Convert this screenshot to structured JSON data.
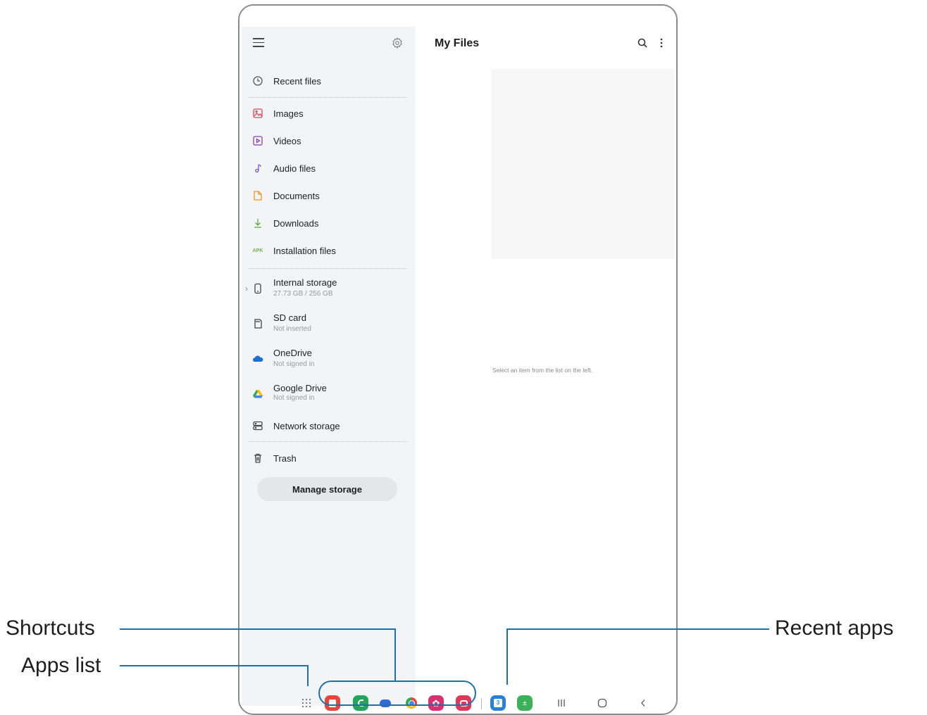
{
  "main": {
    "title": "My Files",
    "empty_message": "Select an item from the list on the left."
  },
  "sidebar": {
    "items": [
      {
        "label": "Recent files"
      },
      {
        "label": "Images"
      },
      {
        "label": "Videos"
      },
      {
        "label": "Audio files"
      },
      {
        "label": "Documents"
      },
      {
        "label": "Downloads"
      },
      {
        "label": "Installation files",
        "badge": "APK"
      },
      {
        "label": "Internal storage",
        "sub": "27.73 GB / 256 GB"
      },
      {
        "label": "SD card",
        "sub": "Not inserted"
      },
      {
        "label": "OneDrive",
        "sub": "Not signed in"
      },
      {
        "label": "Google Drive",
        "sub": "Not signed in"
      },
      {
        "label": "Network storage"
      },
      {
        "label": "Trash"
      }
    ],
    "manage_button": "Manage storage"
  },
  "taskbar": {
    "shortcuts": [
      "notes-app-icon",
      "phone-app-icon",
      "messages-app-icon",
      "chrome-app-icon",
      "bixby-app-icon",
      "camera-app-icon"
    ],
    "recent_apps": [
      "calendar-app-icon",
      "calculator-app-icon"
    ],
    "calendar_day": "3"
  },
  "callouts": {
    "shortcuts": "Shortcuts",
    "apps_list": "Apps list",
    "recent_apps": "Recent apps"
  },
  "colors": {
    "callout_line": "#1f6fa8",
    "sidebar_bg": "#f3f4f6"
  }
}
